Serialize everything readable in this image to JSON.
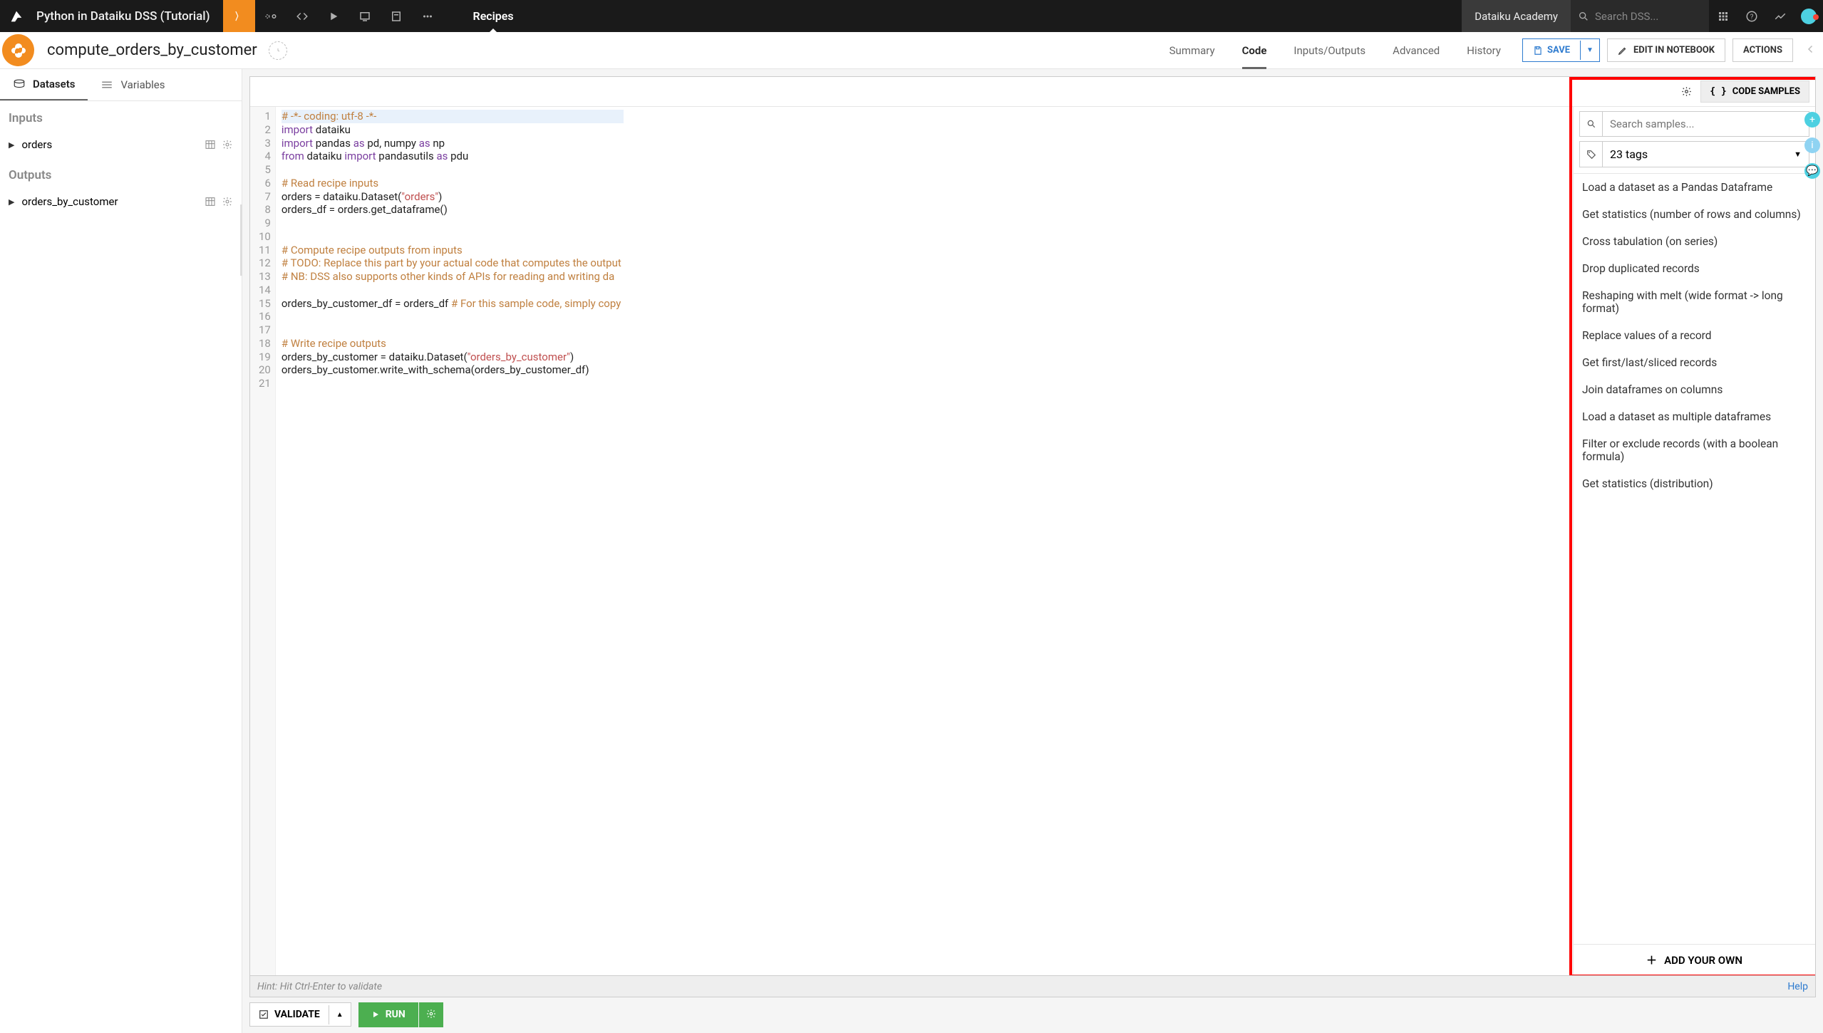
{
  "topnav": {
    "project_title": "Python in Dataiku DSS (Tutorial)",
    "breadcrumb_active": "Recipes",
    "academy_label": "Dataiku Academy",
    "search_placeholder": "Search DSS..."
  },
  "subnav": {
    "recipe_title": "compute_orders_by_customer",
    "tabs": [
      "Summary",
      "Code",
      "Inputs/Outputs",
      "Advanced",
      "History"
    ],
    "active_tab_index": 1,
    "save_label": "SAVE",
    "edit_notebook_label": "EDIT IN NOTEBOOK",
    "actions_label": "ACTIONS"
  },
  "sidebar": {
    "tab_datasets": "Datasets",
    "tab_variables": "Variables",
    "inputs_header": "Inputs",
    "outputs_header": "Outputs",
    "inputs": [
      "orders"
    ],
    "outputs": [
      "orders_by_customer"
    ]
  },
  "editor": {
    "samples_button": "CODE SAMPLES",
    "hint_text": "Hint: Hit Ctrl-Enter to validate",
    "help_label": "Help",
    "validate_label": "VALIDATE",
    "run_label": "RUN",
    "code_lines": [
      {
        "n": 1,
        "segs": [
          {
            "t": "# -*- coding: utf-8 -*-",
            "c": "c-comment"
          }
        ],
        "hl": true
      },
      {
        "n": 2,
        "segs": [
          {
            "t": "import",
            "c": "c-keyword"
          },
          {
            "t": " dataiku",
            "c": "c-plain"
          }
        ]
      },
      {
        "n": 3,
        "segs": [
          {
            "t": "import",
            "c": "c-keyword"
          },
          {
            "t": " pandas ",
            "c": "c-plain"
          },
          {
            "t": "as",
            "c": "c-keyword"
          },
          {
            "t": " pd, numpy ",
            "c": "c-plain"
          },
          {
            "t": "as",
            "c": "c-keyword"
          },
          {
            "t": " np",
            "c": "c-plain"
          }
        ]
      },
      {
        "n": 4,
        "segs": [
          {
            "t": "from",
            "c": "c-keyword"
          },
          {
            "t": " dataiku ",
            "c": "c-plain"
          },
          {
            "t": "import",
            "c": "c-keyword"
          },
          {
            "t": " pandasutils ",
            "c": "c-plain"
          },
          {
            "t": "as",
            "c": "c-keyword"
          },
          {
            "t": " pdu",
            "c": "c-plain"
          }
        ]
      },
      {
        "n": 5,
        "segs": [
          {
            "t": "",
            "c": "c-plain"
          }
        ]
      },
      {
        "n": 6,
        "segs": [
          {
            "t": "# Read recipe inputs",
            "c": "c-comment"
          }
        ]
      },
      {
        "n": 7,
        "segs": [
          {
            "t": "orders = dataiku.Dataset(",
            "c": "c-plain"
          },
          {
            "t": "\"orders\"",
            "c": "c-string"
          },
          {
            "t": ")",
            "c": "c-plain"
          }
        ]
      },
      {
        "n": 8,
        "segs": [
          {
            "t": "orders_df = orders.get_dataframe()",
            "c": "c-plain"
          }
        ]
      },
      {
        "n": 9,
        "segs": [
          {
            "t": "",
            "c": "c-plain"
          }
        ]
      },
      {
        "n": 10,
        "segs": [
          {
            "t": "",
            "c": "c-plain"
          }
        ]
      },
      {
        "n": 11,
        "segs": [
          {
            "t": "# Compute recipe outputs from inputs",
            "c": "c-comment"
          }
        ]
      },
      {
        "n": 12,
        "segs": [
          {
            "t": "# TODO: Replace this part by your actual code that computes the output",
            "c": "c-comment"
          }
        ]
      },
      {
        "n": 13,
        "segs": [
          {
            "t": "# NB: DSS also supports other kinds of APIs for reading and writing da",
            "c": "c-comment"
          }
        ]
      },
      {
        "n": 14,
        "segs": [
          {
            "t": "",
            "c": "c-plain"
          }
        ]
      },
      {
        "n": 15,
        "segs": [
          {
            "t": "orders_by_customer_df = orders_df ",
            "c": "c-plain"
          },
          {
            "t": "# For this sample code, simply copy ",
            "c": "c-comment"
          }
        ]
      },
      {
        "n": 16,
        "segs": [
          {
            "t": "",
            "c": "c-plain"
          }
        ]
      },
      {
        "n": 17,
        "segs": [
          {
            "t": "",
            "c": "c-plain"
          }
        ]
      },
      {
        "n": 18,
        "segs": [
          {
            "t": "# Write recipe outputs",
            "c": "c-comment"
          }
        ]
      },
      {
        "n": 19,
        "segs": [
          {
            "t": "orders_by_customer = dataiku.Dataset(",
            "c": "c-plain"
          },
          {
            "t": "\"orders_by_customer\"",
            "c": "c-string"
          },
          {
            "t": ")",
            "c": "c-plain"
          }
        ]
      },
      {
        "n": 20,
        "segs": [
          {
            "t": "orders_by_customer.write_with_schema(orders_by_customer_df)",
            "c": "c-plain"
          }
        ]
      },
      {
        "n": 21,
        "segs": [
          {
            "t": "",
            "c": "c-plain"
          }
        ]
      }
    ]
  },
  "samples": {
    "search_placeholder": "Search samples...",
    "tags_label": "23 tags",
    "add_own_label": "ADD YOUR OWN",
    "items": [
      "Load a dataset as a Pandas Dataframe",
      "Get statistics (number of rows and columns)",
      "Cross tabulation (on series)",
      "Drop duplicated records",
      "Reshaping with melt (wide format -> long format)",
      "Replace values of a record",
      "Get first/last/sliced records",
      "Join dataframes on columns",
      "Load a dataset as multiple dataframes",
      "Filter or exclude records (with a boolean formula)",
      "Get statistics (distribution)"
    ]
  }
}
